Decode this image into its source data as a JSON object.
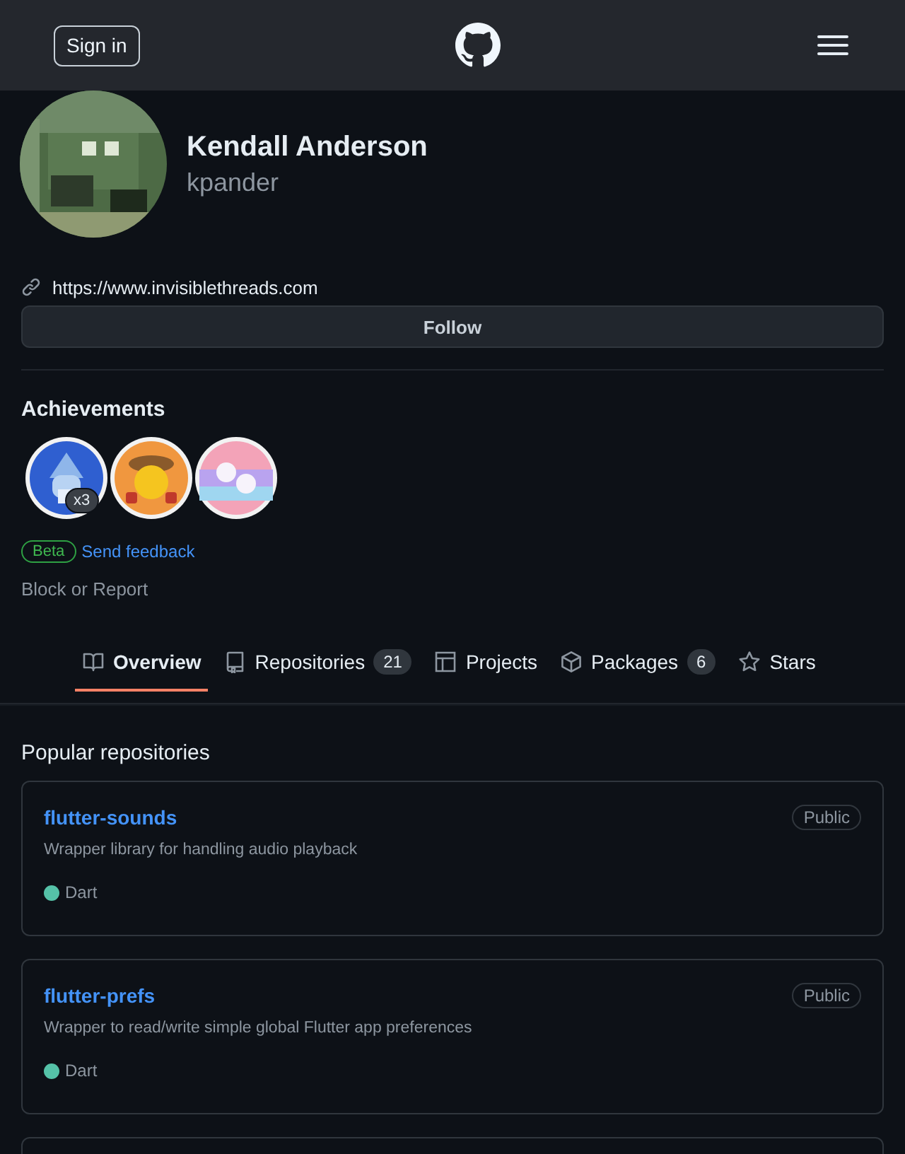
{
  "header": {
    "sign_in": "Sign in"
  },
  "profile": {
    "name": "Kendall Anderson",
    "username": "kpander",
    "website": "https://www.invisiblethreads.com",
    "follow": "Follow"
  },
  "achievements": {
    "title": "Achievements",
    "items": [
      {
        "kind": "fish",
        "count": "x3"
      },
      {
        "kind": "hat"
      },
      {
        "kind": "sticker"
      }
    ],
    "beta": "Beta",
    "feedback": "Send feedback"
  },
  "block_report": "Block or Report",
  "tabs": [
    {
      "kind": "book",
      "label": "Overview",
      "selected": true
    },
    {
      "kind": "repo",
      "label": "Repositories",
      "counter": "21",
      "selected": false
    },
    {
      "kind": "table",
      "label": "Projects",
      "selected": false
    },
    {
      "kind": "package",
      "label": "Packages",
      "counter": "6",
      "selected": false
    },
    {
      "kind": "star",
      "label": "Stars",
      "selected": false
    }
  ],
  "popular": {
    "title": "Popular repositories",
    "repos": [
      {
        "name": "flutter-sounds",
        "visibility": "Public",
        "description": "Wrapper library for handling audio playback",
        "language": "Dart",
        "color": "#55c2a8"
      },
      {
        "name": "flutter-prefs",
        "visibility": "Public",
        "description": "Wrapper to read/write simple global Flutter app preferences",
        "language": "Dart",
        "color": "#55c2a8"
      }
    ]
  }
}
